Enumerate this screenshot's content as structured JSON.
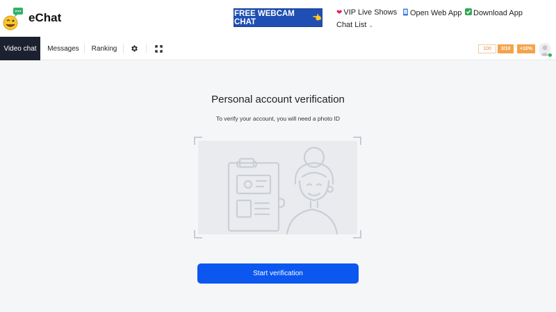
{
  "header": {
    "brand": "eChat",
    "logo_icon": "smiley-chat-logo-icon",
    "cta_label": "FREE WEBCAM CHAT",
    "cta_icon": "pointing-hand-icon",
    "links": [
      {
        "icon": "heart-icon",
        "label": "VIP Live Shows"
      },
      {
        "icon": "phone-icon",
        "label": "Open Web App"
      },
      {
        "icon": "checkmark-icon",
        "label": "Download App"
      }
    ],
    "chat_list_label": "Chat List",
    "chat_list_icon": "chevron-down-icon"
  },
  "tabs": {
    "items": [
      {
        "label": "Video chat",
        "active": true
      },
      {
        "label": "Messages",
        "active": false
      },
      {
        "label": "Ranking",
        "active": false
      }
    ],
    "settings_icon": "gear-icon",
    "fullscreen_icon": "fullscreen-icon"
  },
  "badges": {
    "coins": "100",
    "level": "3/10",
    "bonus": "+10%"
  },
  "user": {
    "avatar_icon": "avatar-icon",
    "status": "online"
  },
  "verification": {
    "title": "Personal account verification",
    "subtitle": "To verify your account, you will need a photo ID",
    "illustration_icon": "person-holding-id-icon",
    "button_label": "Start verification"
  },
  "colors": {
    "primary": "#0b57f0",
    "cta": "#1f4fb4",
    "active_tab": "#1c2130",
    "badge": "#f5a34a",
    "online": "#2bb24c",
    "background": "#f5f6f8"
  }
}
